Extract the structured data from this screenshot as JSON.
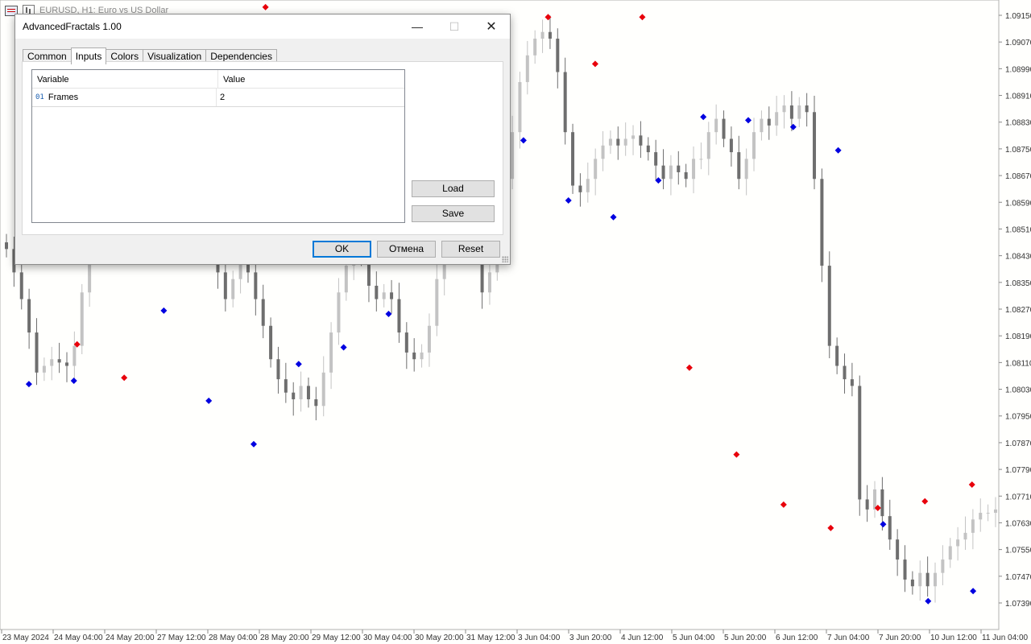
{
  "chart": {
    "title": "EURUSD, H1:  Euro vs US Dollar",
    "y_ticks": [
      "1.09150",
      "1.09070",
      "1.08990",
      "1.08910",
      "1.08830",
      "1.08750",
      "1.08670",
      "1.08590",
      "1.08510",
      "1.08430",
      "1.08350",
      "1.08270",
      "1.08190",
      "1.08110",
      "1.08030",
      "1.07950",
      "1.07870",
      "1.07790",
      "1.07710",
      "1.07630",
      "1.07550",
      "1.07470",
      "1.07390"
    ],
    "x_ticks": [
      "23 May 2024",
      "24 May 04:00",
      "24 May 20:00",
      "27 May 12:00",
      "28 May 04:00",
      "28 May 20:00",
      "29 May 12:00",
      "30 May 04:00",
      "30 May 20:00",
      "31 May 12:00",
      "3 Jun 04:00",
      "3 Jun 20:00",
      "4 Jun 12:00",
      "5 Jun 04:00",
      "5 Jun 20:00",
      "6 Jun 12:00",
      "7 Jun 04:00",
      "7 Jun 20:00",
      "10 Jun 12:00",
      "11 Jun 04:00"
    ],
    "colors": {
      "up_fractal": "#e8000b",
      "down_fractal": "#0000e0",
      "bear_candle": "#6e6e6e",
      "bull_candle": "#c3c3c3"
    }
  },
  "chart_data": {
    "type": "candlestick",
    "title": "EURUSD, H1:  Euro vs US Dollar",
    "ylim": [
      1.0733,
      1.0918
    ],
    "price_series": [
      1.0845,
      1.0838,
      1.083,
      1.082,
      1.0808,
      1.081,
      1.0812,
      1.0811,
      1.081,
      1.0816,
      1.0832,
      1.0849,
      1.0858,
      1.0862,
      1.0866,
      1.087,
      1.0872,
      1.0869,
      1.0865,
      1.086,
      1.0858,
      1.0862,
      1.0866,
      1.087,
      1.0866,
      1.086,
      1.0856,
      1.0848,
      1.0838,
      1.083,
      1.0836,
      1.0842,
      1.0838,
      1.083,
      1.0822,
      1.0812,
      1.0806,
      1.0802,
      1.08,
      1.0804,
      1.08,
      1.0798,
      1.0808,
      1.082,
      1.0832,
      1.084,
      1.0846,
      1.0843,
      1.0834,
      1.083,
      1.0832,
      1.083,
      1.082,
      1.0814,
      1.0812,
      1.0814,
      1.0822,
      1.0836,
      1.0846,
      1.085,
      1.0852,
      1.0853,
      1.0846,
      1.0832,
      1.0838,
      1.0852,
      1.0866,
      1.088,
      1.0895,
      1.0903,
      1.0908,
      1.091,
      1.0908,
      1.0898,
      1.088,
      1.0864,
      1.0862,
      1.0866,
      1.0872,
      1.0876,
      1.0878,
      1.0876,
      1.0878,
      1.0879,
      1.0876,
      1.0874,
      1.087,
      1.0866,
      1.087,
      1.0868,
      1.0866,
      1.0872,
      1.0872,
      1.088,
      1.0884,
      1.0878,
      1.0874,
      1.0866,
      1.0872,
      1.088,
      1.0884,
      1.0882,
      1.0886,
      1.0888,
      1.0884,
      1.0888,
      1.0886,
      1.0866,
      1.084,
      1.0816,
      1.081,
      1.0806,
      1.0804,
      1.077,
      1.0767,
      1.0773,
      1.0765,
      1.0758,
      1.0752,
      1.0746,
      1.0744,
      1.0748,
      1.0744,
      1.0748,
      1.0752,
      1.0756,
      1.0758,
      1.076,
      1.0764,
      1.0766,
      1.0766,
      1.0767
    ],
    "fractals_up": [
      1.0859,
      1.0815,
      1.0805,
      1.0859,
      1.0911,
      1.0916,
      1.0882,
      1.0893,
      1.0878,
      1.0904,
      1.0888,
      1.0913,
      1.0899,
      1.0913,
      1.0808,
      1.0782,
      1.0767,
      1.076,
      1.0766,
      1.0768,
      1.0773
    ],
    "fractals_down": [
      1.0806,
      1.0807,
      1.0844,
      1.0828,
      1.0801,
      1.0788,
      1.0812,
      1.0817,
      1.0827,
      1.0903,
      1.0859,
      1.0879,
      1.0861,
      1.0856,
      1.0867,
      1.0886,
      1.0885,
      1.0883,
      1.0876,
      1.0764,
      1.0741,
      1.0744
    ]
  },
  "dialog": {
    "title": "AdvancedFractals 1.00",
    "tabs": [
      "Common",
      "Inputs",
      "Colors",
      "Visualization",
      "Dependencies"
    ],
    "active_tab": "Inputs",
    "columns": [
      "Variable",
      "Value"
    ],
    "rows": [
      {
        "type_icon": "01",
        "variable": "Frames",
        "value": "2"
      }
    ],
    "buttons": {
      "load": "Load",
      "save": "Save",
      "ok": "OK",
      "cancel": "Отмена",
      "reset": "Reset"
    }
  }
}
